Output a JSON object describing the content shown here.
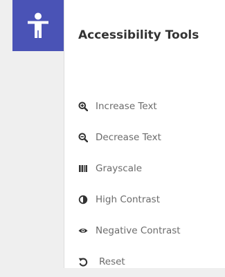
{
  "toggle": {
    "icon": "accessibility-person-icon",
    "color": "#4a53b6"
  },
  "panel": {
    "title": "Accessibility Tools",
    "tools": [
      {
        "label": "Increase Text",
        "icon": "zoom-in-icon"
      },
      {
        "label": "Decrease Text",
        "icon": "zoom-out-icon"
      },
      {
        "label": "Grayscale",
        "icon": "grayscale-bars-icon"
      },
      {
        "label": "High Contrast",
        "icon": "contrast-half-circle-icon"
      },
      {
        "label": "Negative Contrast",
        "icon": "eye-icon"
      },
      {
        "label": "Reset",
        "icon": "undo-icon"
      }
    ]
  }
}
